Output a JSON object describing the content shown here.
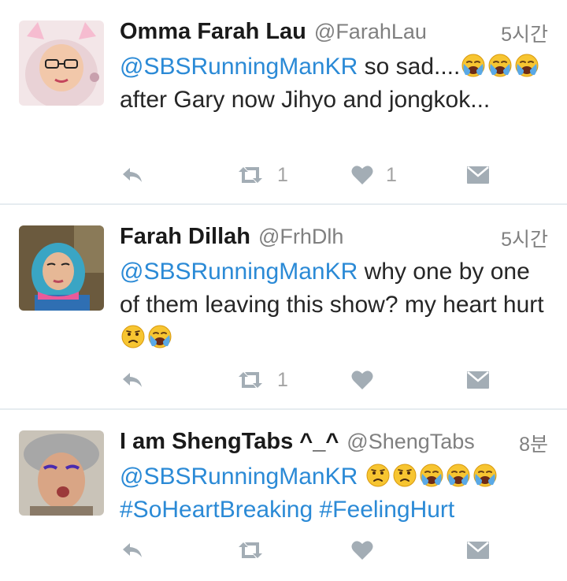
{
  "tweets": [
    {
      "name": "Omma Farah Lau",
      "handle": "@FarahLau",
      "time": "5시간",
      "mention": "@SBSRunningManKR",
      "text_a": " so sad....",
      "text_b": " after Gary now Jihyo and jongkok...",
      "emoji": [
        "loudly-crying-face",
        "loudly-crying-face",
        "loudly-crying-face"
      ],
      "retweets": "1",
      "likes": "1"
    },
    {
      "name": "Farah Dillah",
      "handle": "@FrhDlh",
      "time": "5시간",
      "mention": "@SBSRunningManKR",
      "text_a": " why one by one of them leaving this show? my heart hurt ",
      "emoji": [
        "confused-face",
        "loudly-crying-face"
      ],
      "retweets": "1",
      "likes": ""
    },
    {
      "name": "I am ShengTabs ^_^",
      "handle": "@ShengTabs",
      "time": "8분",
      "mention": "@SBSRunningManKR",
      "emoji": [
        "confused-face",
        "confused-face",
        "loudly-crying-face",
        "loudly-crying-face",
        "loudly-crying-face"
      ],
      "hashtag_1": "#SoHeartBreaking",
      "hashtag_2": "#FeelingHurt",
      "retweets": "",
      "likes": ""
    }
  ],
  "colors": {
    "link": "#2b8ad6",
    "action_icon": "#a3adb5",
    "meta_text": "#808080",
    "divider": "#e6ecf0"
  },
  "icons": [
    "reply-icon",
    "retweet-icon",
    "heart-icon",
    "direct-message-icon"
  ]
}
